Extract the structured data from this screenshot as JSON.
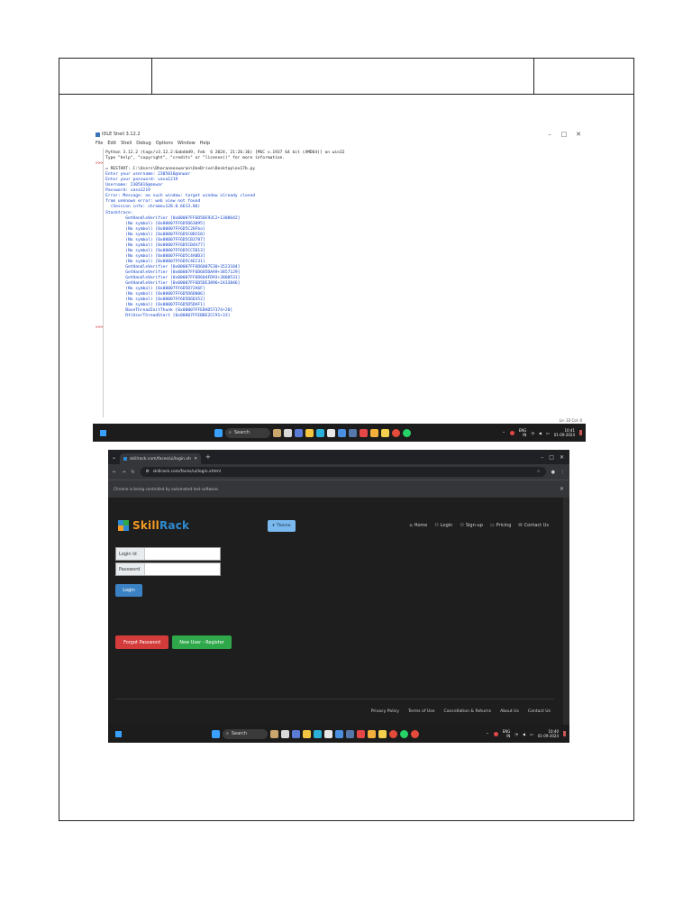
{
  "document": {
    "header_cells": [
      "",
      "",
      ""
    ]
  },
  "idle": {
    "window_title": "IDLE Shell 3.12.2",
    "window_controls": [
      "–",
      "□",
      "✕"
    ],
    "menu": [
      "File",
      "Edit",
      "Shell",
      "Debug",
      "Options",
      "Window",
      "Help"
    ],
    "lines": [
      {
        "text": "    Python 3.12.2 (tags/v3.12.2:6abddd9, Feb  6 2024, 21:26:36) [MSC v.1937 64 bit (AMD64)] on win32",
        "cls": ""
      },
      {
        "text": "    Type \"help\", \"copyright\", \"credits\" or \"license()\" for more information.",
        "cls": ""
      },
      {
        "text": ">>>",
        "cls": "red"
      },
      {
        "text": "    = RESTART: C:\\Users\\Dharaneeswaran\\OneDrive\\Desktop\\ex17b.py",
        "cls": ""
      },
      {
        "text": "    Enter your username: 2305016@anwar",
        "cls": "blue"
      },
      {
        "text": "    Enter your password: vasa1219",
        "cls": "blue"
      },
      {
        "text": "    Username: 2305016@anwar",
        "cls": "blue"
      },
      {
        "text": "    Password: vasa1219",
        "cls": "blue"
      },
      {
        "text": "    Error: Message: no such window: target window already closed",
        "cls": "blue"
      },
      {
        "text": "    from unknown error: web view not found",
        "cls": "blue"
      },
      {
        "text": "      (Session info: chrome=128.0.6613.86)",
        "cls": "blue"
      },
      {
        "text": "    Stacktrace:",
        "cls": "blue"
      },
      {
        "text": "            GetHandleVerifier [0x00007FF6D5DE93C2+1308642]",
        "cls": "blue"
      },
      {
        "text": "            (No symbol) [0x00007FF6D5D63095]",
        "cls": "blue"
      },
      {
        "text": "            (No symbol) [0x00007FF6D5C26Fba]",
        "cls": "blue"
      },
      {
        "text": "            (No symbol) [0x00007FF6D5C0DCE0]",
        "cls": "blue"
      },
      {
        "text": "            (No symbol) [0x00007FF6D5CB3787]",
        "cls": "blue"
      },
      {
        "text": "            (No symbol) [0x00007FF6D5CB4A77]",
        "cls": "blue"
      },
      {
        "text": "            (No symbol) [0x00007FF6D5CC5D13]",
        "cls": "blue"
      },
      {
        "text": "            (No symbol) [0x00007FF6D5C4A8D3]",
        "cls": "blue"
      },
      {
        "text": "            (No symbol) [0x00007FF6D5C4EC31]",
        "cls": "blue"
      },
      {
        "text": "            GetHandleVerifier [0x00007FF6D6007E30+3523184]",
        "cls": "blue"
      },
      {
        "text": "            GetHandleVerifier [0x00007FF6D605DAA9+3857129]",
        "cls": "blue"
      },
      {
        "text": "            GetHandleVerifier [0x00007FF6D604FD93+3800531]",
        "cls": "blue"
      },
      {
        "text": "            GetHandleVerifier [0x00007FF6D5DE3896+2433846]",
        "cls": "blue"
      },
      {
        "text": "            (No symbol) [0x00007FF6D5D72A6F]",
        "cls": "blue"
      },
      {
        "text": "            (No symbol) [0x00007FF6D5D6D006]",
        "cls": "blue"
      },
      {
        "text": "            (No symbol) [0x00007FF6D5D6D352]",
        "cls": "blue"
      },
      {
        "text": "            (No symbol) [0x00007FF6D5D5DAF1]",
        "cls": "blue"
      },
      {
        "text": "            BaseThreadInitThunk [0x00007FFEBAD57374+20]",
        "cls": "blue"
      },
      {
        "text": "            RtlUserThreadStart [0x00007FFEBBE2CC91+33]",
        "cls": "blue"
      },
      {
        "text": "",
        "cls": ""
      },
      {
        "text": ">>>",
        "cls": "red"
      }
    ],
    "status": "Ln: 33  Col: 0"
  },
  "taskbar1": {
    "search": "Search",
    "lang_top": "ENG",
    "lang_bottom": "IN",
    "time": "10:41",
    "date": "01-09-2024"
  },
  "chrome": {
    "tab_title": "skillrack.com/faces/ui/login.xh",
    "url": "skillrack.com/faces/ui/login.xhtml",
    "automation_notice": "Chrome is being controlled by automated test software.",
    "window_controls": [
      "–",
      "□",
      "✕"
    ]
  },
  "site": {
    "logo_part1": "Skill",
    "logo_part2": "Rack",
    "theme_label": "Theme",
    "nav": [
      {
        "icon": "⌂",
        "label": "Home"
      },
      {
        "icon": "⚇",
        "label": "Login"
      },
      {
        "icon": "⚇",
        "label": "Sign-up"
      },
      {
        "icon": "▭",
        "label": "Pricing"
      },
      {
        "icon": "✉",
        "label": "Contact Us"
      }
    ],
    "login_id_placeholder": "Login Id",
    "password_placeholder": "Password",
    "login_button": "Login",
    "forgot_button": "Forgot Password",
    "register_button": "New User - Register",
    "footer": [
      "Privacy Policy",
      "Terms of Use",
      "Cancellation & Returns",
      "About Us",
      "Contact Us"
    ],
    "colors": {
      "orange": "#f59a23",
      "blue": "#2e8bd0",
      "green": "#2fa84b",
      "red": "#d43c3c"
    }
  },
  "taskbar2": {
    "search": "Search",
    "lang_top": "ENG",
    "lang_bottom": "IN",
    "time": "10:40",
    "date": "01-09-2024"
  }
}
